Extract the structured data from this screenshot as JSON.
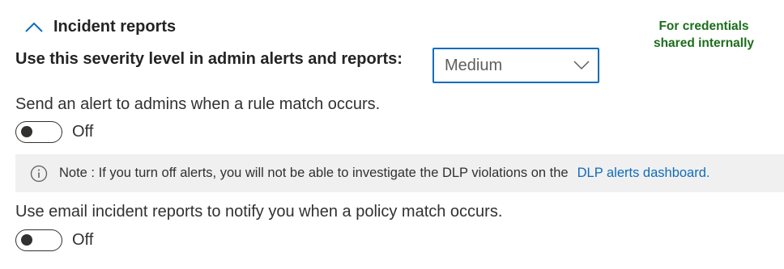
{
  "section": {
    "title": "Incident reports",
    "expanded": true
  },
  "annotation": {
    "line1": "For credentials",
    "line2": "shared internally",
    "color": "#1b6e1b"
  },
  "severity": {
    "label": "Use this severity level in admin alerts and reports:",
    "selected": "Medium"
  },
  "alert_toggle": {
    "label": "Send an alert to admins when a rule match occurs.",
    "state_text": "Off",
    "on": false
  },
  "note": {
    "icon": "info-icon",
    "text": "Note : If you turn off alerts, you will not be able to investigate the DLP violations on the",
    "link_text": "DLP alerts dashboard."
  },
  "email_toggle": {
    "label": "Use email incident reports to notify you when a policy match occurs.",
    "state_text": "Off",
    "on": false
  },
  "colors": {
    "accent": "#0f6cbd",
    "note_background": "#f0f0f0"
  }
}
